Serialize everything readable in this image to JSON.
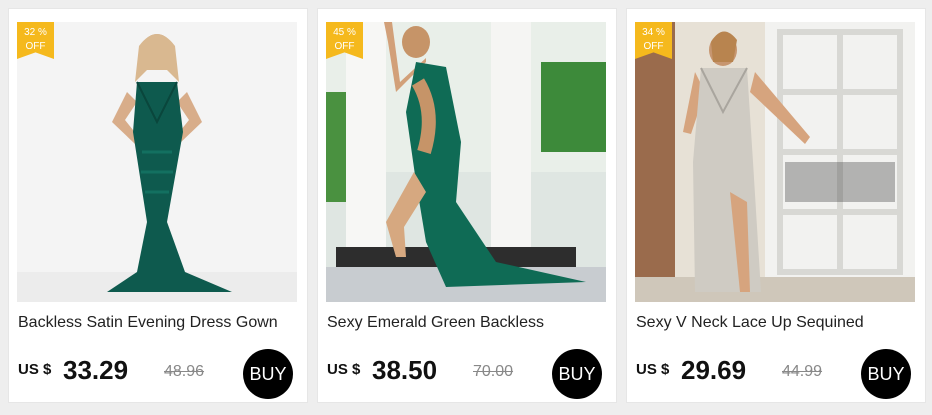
{
  "products": [
    {
      "badge_percent": "32 %",
      "badge_off": "OFF",
      "title": "Backless Satin Evening Dress Gown",
      "currency": "US $",
      "price": "33.29",
      "old_price": "48.96",
      "buy_label": "BUY",
      "dress_color": "#0e5a4e"
    },
    {
      "badge_percent": "45 %",
      "badge_off": "OFF",
      "title": "Sexy Emerald Green Backless",
      "currency": "US $",
      "price": "38.50",
      "old_price": "70.00",
      "buy_label": "BUY",
      "dress_color": "#0f6b55"
    },
    {
      "badge_percent": "34 %",
      "badge_off": "OFF",
      "title": "Sexy V Neck Lace Up Sequined",
      "currency": "US $",
      "price": "29.69",
      "old_price": "44.99",
      "buy_label": "BUY",
      "dress_color": "#cfcbc3"
    }
  ],
  "colors": {
    "badge": "#f5b91d",
    "buy_button": "#000000",
    "page_bg": "#eeeeee"
  }
}
